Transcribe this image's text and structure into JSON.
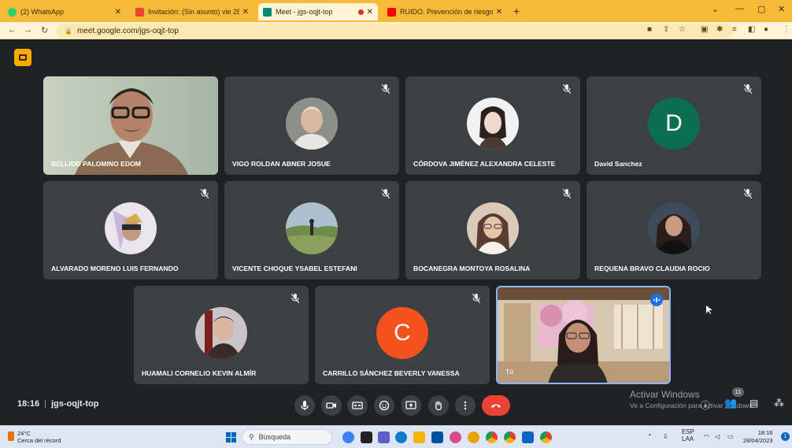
{
  "browser": {
    "tabs": [
      {
        "title": "(2) WhatsApp",
        "color": "#25d366",
        "active": false
      },
      {
        "title": "Invitación: (Sin asunto) vie 28 de",
        "color": "#ea4335",
        "active": false
      },
      {
        "title": "Meet - jgs-oqjt-top",
        "color": "#00897b",
        "active": true
      },
      {
        "title": "RUIDO. Prevención de riesgos la",
        "color": "#ff0000",
        "active": false
      }
    ],
    "url": "meet.google.com/jgs-oqjt-top"
  },
  "meet": {
    "participants": [
      {
        "name": "BELLIDO PALOMINO EDOM",
        "type": "video",
        "muted": false
      },
      {
        "name": "VIGO ROLDAN ABNER JOSUE",
        "type": "photo",
        "muted": true,
        "photo_bg": "#8d8f8a",
        "photo_fg": "#d9d4cf"
      },
      {
        "name": "CÓRDOVA JIMÉNEZ ALEXANDRA CELESTE",
        "type": "photo",
        "muted": true,
        "photo_bg": "#f2f2f2",
        "photo_fg": "#3a2f2c"
      },
      {
        "name": "David Sanchez",
        "type": "letter",
        "letter": "D",
        "color": "#0b6e4f",
        "muted": true
      },
      {
        "name": "ALVARADO MORENO LUIS FERNANDO",
        "type": "photo",
        "muted": true,
        "photo_bg": "#e9e4ee",
        "photo_fg": "#7a6a8a"
      },
      {
        "name": "VICENTE CHOQUE YSABEL ESTEFANI",
        "type": "photo",
        "muted": true,
        "photo_bg": "#a7b7c7",
        "photo_fg": "#6f8a4d"
      },
      {
        "name": "BOCANEGRA MONTOYA ROSALINA",
        "type": "photo",
        "muted": true,
        "photo_bg": "#d9cbb8",
        "photo_fg": "#5a3d2e"
      },
      {
        "name": "REQUENA BRAVO CLAUDIA ROCIO",
        "type": "photo",
        "muted": true,
        "photo_bg": "#3d4a5c",
        "photo_fg": "#2a1d1a"
      },
      {
        "name": "HUAMALI CORNELIO KEVIN ALMÍR",
        "type": "photo",
        "muted": true,
        "photo_bg": "#c9c4c9",
        "photo_fg": "#3a2a2a"
      },
      {
        "name": "CARRILLO SÁNCHEZ BEVERLY VANESSA",
        "type": "letter",
        "letter": "C",
        "color": "#f4511e",
        "muted": true
      },
      {
        "name": "Tú",
        "type": "self",
        "muted": false
      }
    ],
    "time": "18:16",
    "meeting_code": "jgs-oqjt-top",
    "participant_count": "11",
    "activate_title": "Activar Windows",
    "activate_sub": "Ve a Configuración para activar Windows."
  },
  "taskbar": {
    "temperature": "24°C",
    "weather_text": "Cerca del récord",
    "search_placeholder": "Búsqueda",
    "lang1": "ESP",
    "lang2": "LAA",
    "time": "18:16",
    "date": "28/04/2023"
  }
}
